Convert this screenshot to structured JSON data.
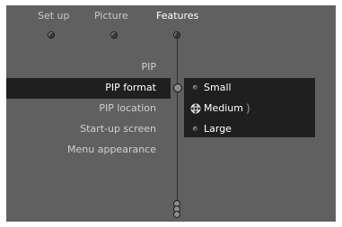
{
  "tabs": [
    {
      "label": "Set up",
      "active": false
    },
    {
      "label": "Picture",
      "active": false
    },
    {
      "label": "Features",
      "active": true
    }
  ],
  "menu_items": [
    {
      "label": "PIP",
      "selected": false
    },
    {
      "label": "PIP format",
      "selected": true
    },
    {
      "label": "PIP location",
      "selected": false
    },
    {
      "label": "Start-up screen",
      "selected": false
    },
    {
      "label": "Menu appearance",
      "selected": false
    }
  ],
  "options": [
    {
      "label": "Small",
      "focused": false
    },
    {
      "label": "Medium",
      "focused": true
    },
    {
      "label": "Large",
      "focused": false
    }
  ],
  "colors": {
    "screen_bg": "#606060",
    "highlight_bg": "#1f1f1f",
    "text": "#ffffff"
  }
}
